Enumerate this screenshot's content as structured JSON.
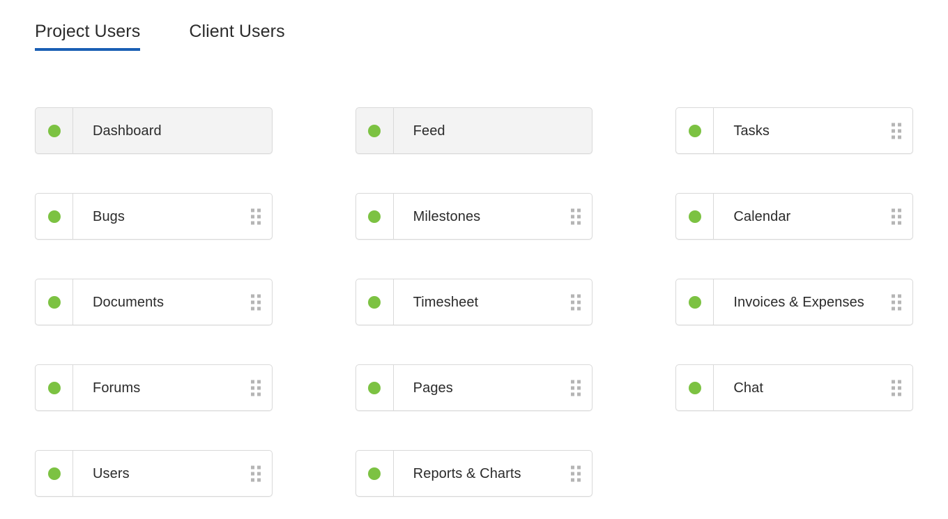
{
  "tabs": [
    {
      "label": "Project Users",
      "active": true
    },
    {
      "label": "Client Users",
      "active": false
    }
  ],
  "colors": {
    "status_enabled": "#7cc242",
    "active_tab_underline": "#1a5fb4",
    "card_border": "#d9d9d9",
    "card_highlight_bg": "#f3f3f3",
    "text": "#2b2b2b",
    "drag_dot": "#b5b5b5"
  },
  "icons": {
    "status": "green-dot-icon",
    "drag": "drag-handle-icon"
  },
  "modules": {
    "columns": [
      [
        {
          "label": "Dashboard",
          "enabled": true,
          "highlighted": true,
          "draggable": false
        },
        {
          "label": "Bugs",
          "enabled": true,
          "highlighted": false,
          "draggable": true
        },
        {
          "label": "Documents",
          "enabled": true,
          "highlighted": false,
          "draggable": true
        },
        {
          "label": "Forums",
          "enabled": true,
          "highlighted": false,
          "draggable": true
        },
        {
          "label": "Users",
          "enabled": true,
          "highlighted": false,
          "draggable": true
        }
      ],
      [
        {
          "label": "Feed",
          "enabled": true,
          "highlighted": true,
          "draggable": false
        },
        {
          "label": "Milestones",
          "enabled": true,
          "highlighted": false,
          "draggable": true
        },
        {
          "label": "Timesheet",
          "enabled": true,
          "highlighted": false,
          "draggable": true
        },
        {
          "label": "Pages",
          "enabled": true,
          "highlighted": false,
          "draggable": true
        },
        {
          "label": "Reports & Charts",
          "enabled": true,
          "highlighted": false,
          "draggable": true
        }
      ],
      [
        {
          "label": "Tasks",
          "enabled": true,
          "highlighted": false,
          "draggable": true
        },
        {
          "label": "Calendar",
          "enabled": true,
          "highlighted": false,
          "draggable": true
        },
        {
          "label": "Invoices & Expenses",
          "enabled": true,
          "highlighted": false,
          "draggable": true
        },
        {
          "label": "Chat",
          "enabled": true,
          "highlighted": false,
          "draggable": true
        }
      ]
    ]
  }
}
